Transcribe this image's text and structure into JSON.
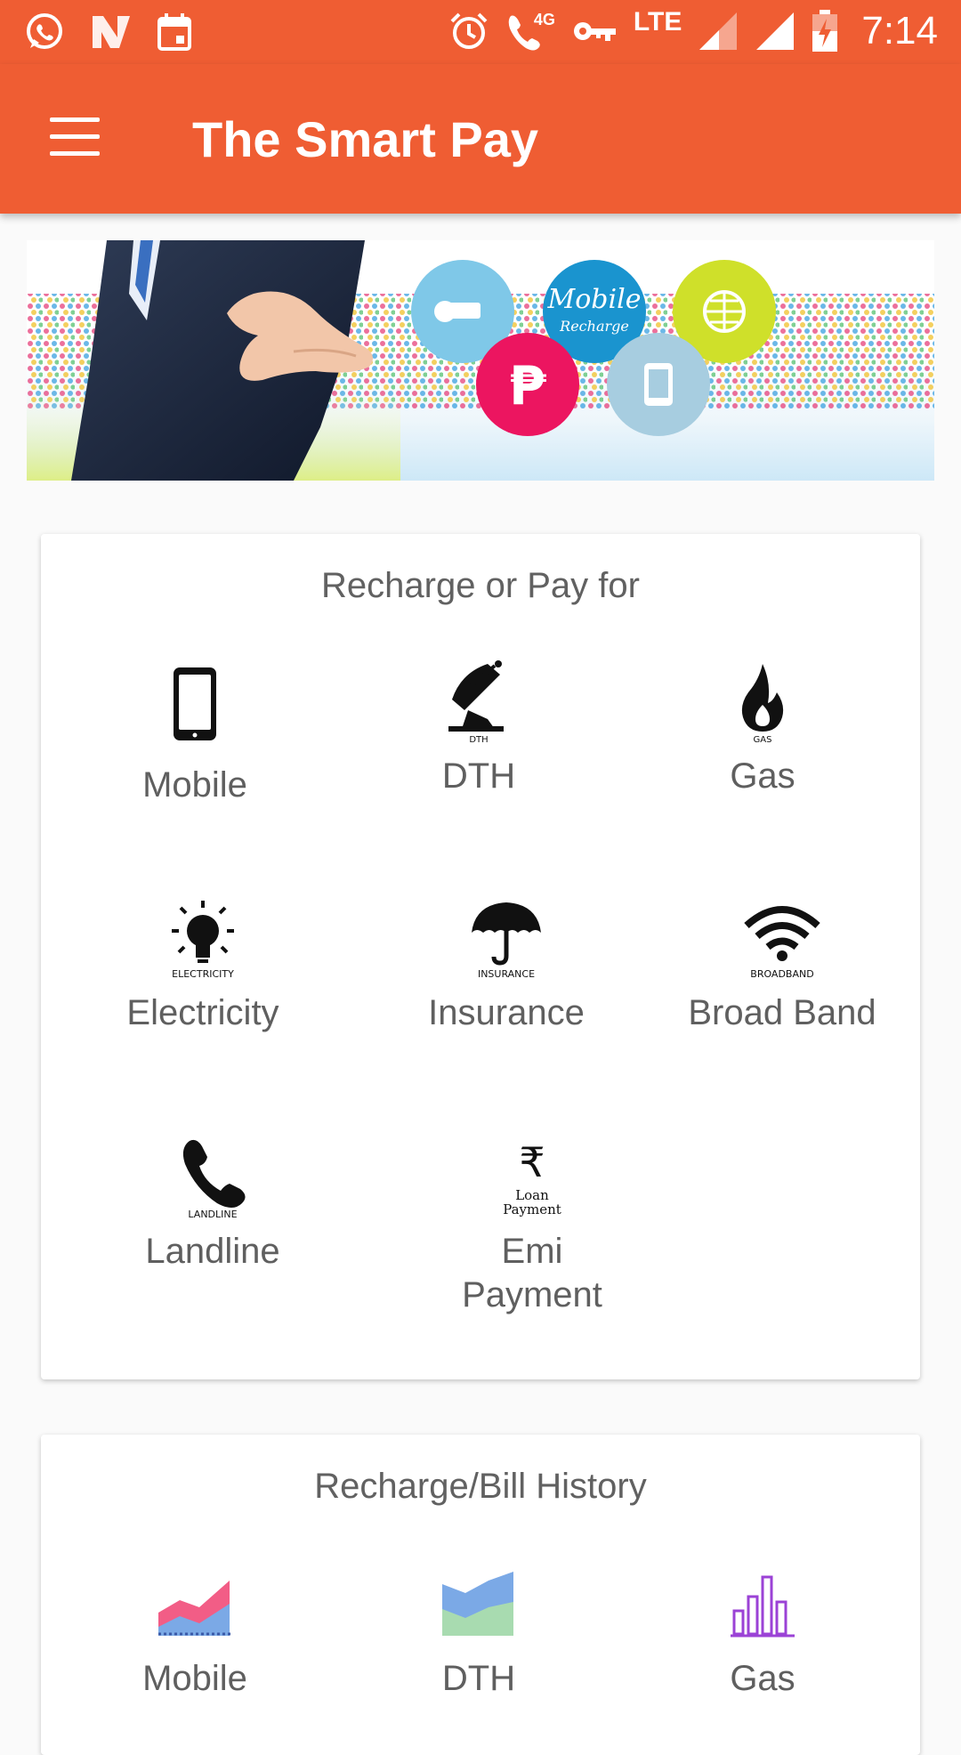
{
  "status_bar": {
    "time": "7:14",
    "network": "LTE",
    "call_badge": "4G",
    "left_icons": [
      "whatsapp-icon",
      "n-app-icon",
      "calendar-icon"
    ],
    "right_icons": [
      "alarm-icon",
      "volte-call-icon",
      "vpn-key-icon",
      "signal-icon",
      "signal-icon",
      "battery-icon"
    ]
  },
  "app_bar": {
    "title": "The Smart Pay",
    "menu_icon": "hamburger-menu-icon",
    "color": "#ef5d33"
  },
  "banner": {
    "bubble_text_1": "Mobile",
    "bubble_text_2": "Recharge",
    "currency_symbol": "₱"
  },
  "recharge_card": {
    "title": "Recharge or Pay for",
    "items": [
      {
        "label": "Mobile",
        "icon": "mobile-phone-icon",
        "caption": ""
      },
      {
        "label": "DTH",
        "icon": "satellite-dish-icon",
        "caption": "DTH"
      },
      {
        "label": "Gas",
        "icon": "flame-icon",
        "caption": "GAS"
      },
      {
        "label": "Electricity",
        "icon": "light-bulb-icon",
        "caption": "ELECTRICITY"
      },
      {
        "label": "Insurance",
        "icon": "umbrella-icon",
        "caption": "INSURANCE"
      },
      {
        "label": "Broad Band",
        "icon": "wifi-icon",
        "caption": "BROADBAND"
      },
      {
        "label": "Landline",
        "icon": "telephone-icon",
        "caption": "LANDLINE"
      },
      {
        "label": "Emi Payment",
        "icon": "rupee-icon",
        "caption": "Loan Payment",
        "caption_line1": "Loan",
        "caption_line2": "Payment",
        "label_line1": "Emi",
        "label_line2": "Payment",
        "rupee": "₹"
      }
    ]
  },
  "history_card": {
    "title": "Recharge/Bill History",
    "items": [
      {
        "label": "Mobile",
        "icon": "area-chart-icon"
      },
      {
        "label": "DTH",
        "icon": "area-chart-icon"
      },
      {
        "label": "Gas",
        "icon": "bar-chart-icon"
      }
    ]
  },
  "colors": {
    "primary": "#ef5d33",
    "label_text": "#5f5f5f",
    "chart_pink": "#f25d86",
    "chart_blue": "#7ba9e6",
    "chart_green": "#a8dbb0",
    "chart_purple": "#9b42d6"
  }
}
